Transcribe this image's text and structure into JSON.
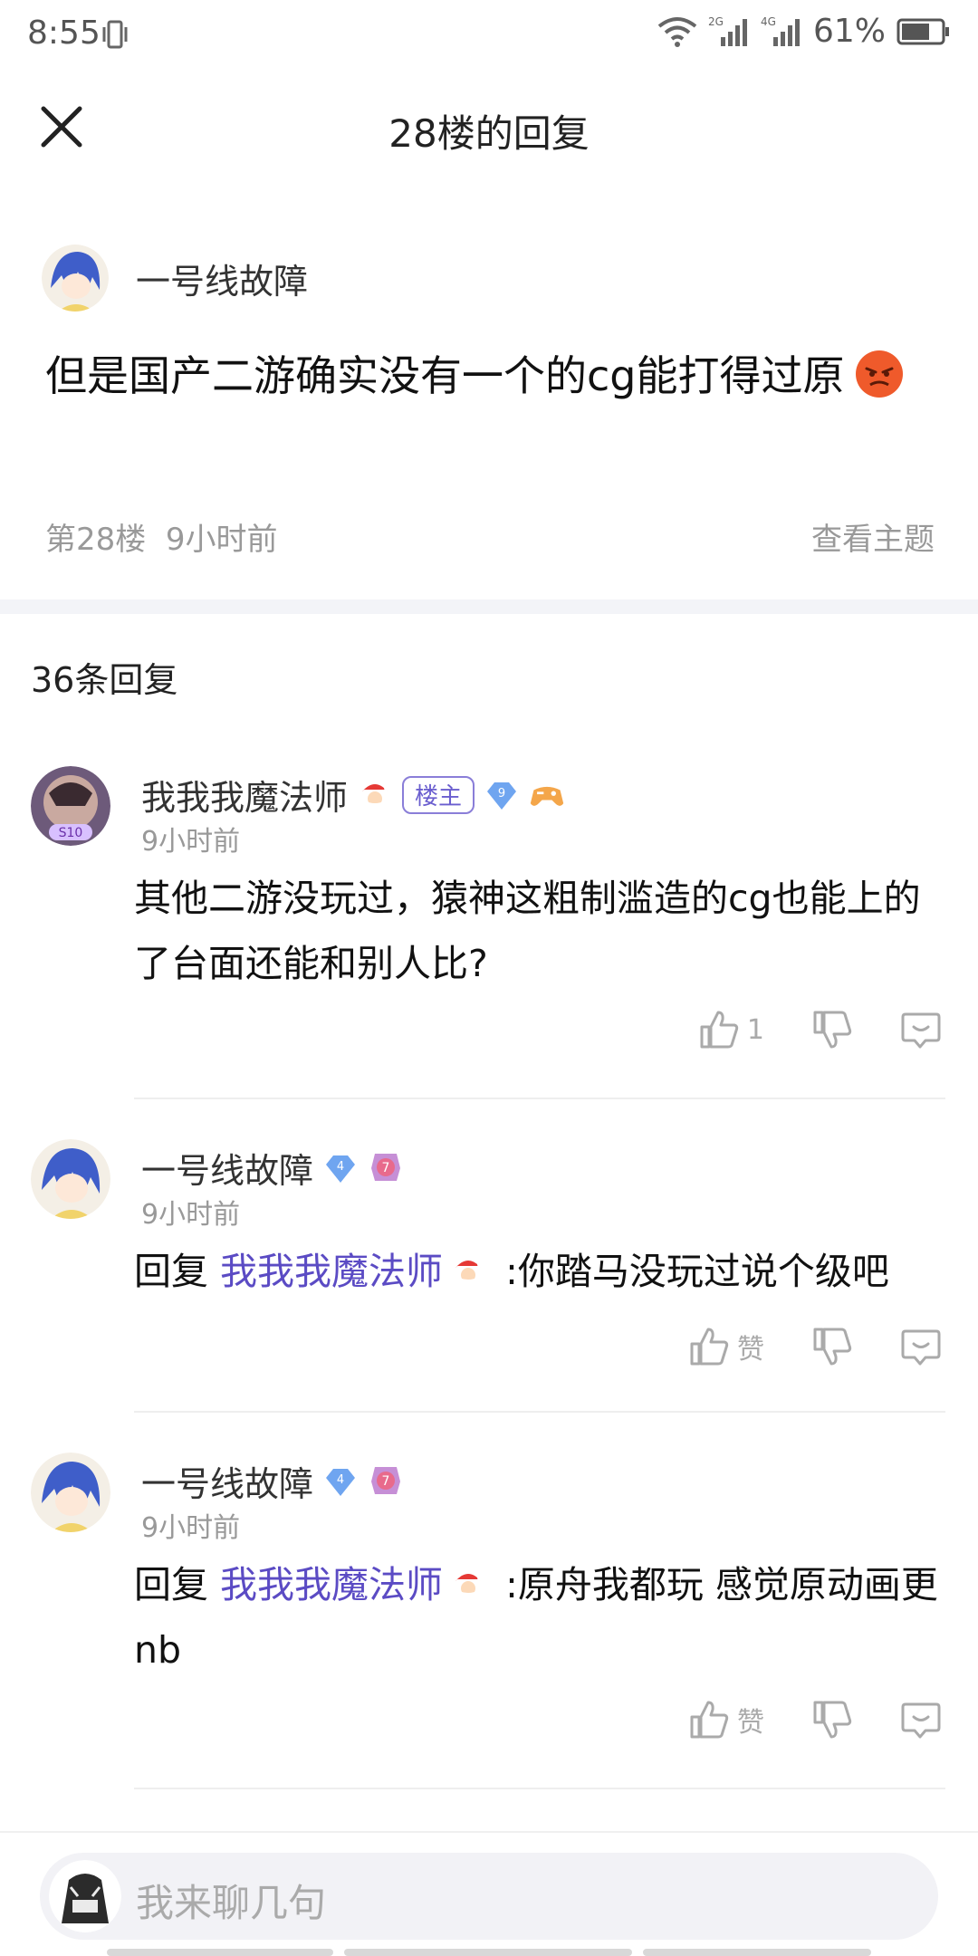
{
  "status_bar": {
    "time": "8:55",
    "battery": "61%",
    "net1": "2G",
    "net2": "4G"
  },
  "header": {
    "title": "28楼的回复"
  },
  "op": {
    "author": "一号线故障",
    "content": "但是国产二游确实没有一个的cg能打得过原",
    "floor": "第28楼",
    "time": "9小时前",
    "view_thread": "查看主题"
  },
  "replies_header": {
    "count_label": "36条回复"
  },
  "replies": [
    {
      "author": "我我我魔法师",
      "owner_badge": "楼主",
      "gem_level": "9",
      "time": "9小时前",
      "text": "其他二游没玩过，猿神这粗制滥造的cg也能上的了台面还能和别人比?",
      "like_label": "1"
    },
    {
      "author": "一号线故障",
      "gem_level": "4",
      "badge_level": "7",
      "time": "9小时前",
      "reply_prefix": "回复 ",
      "mention": "我我我魔法师",
      "text": " :你踏马没玩过说个级吧",
      "like_label": "赞"
    },
    {
      "author": "一号线故障",
      "gem_level": "4",
      "badge_level": "7",
      "time": "9小时前",
      "reply_prefix": "回复 ",
      "mention": "我我我魔法师",
      "text": " :原舟我都玩 感觉原动画更nb",
      "like_label": "赞"
    }
  ],
  "input": {
    "placeholder": "我来聊几句"
  },
  "colors": {
    "accent": "#5b4bc4",
    "muted": "#999999",
    "band": "#f3f4f8"
  }
}
